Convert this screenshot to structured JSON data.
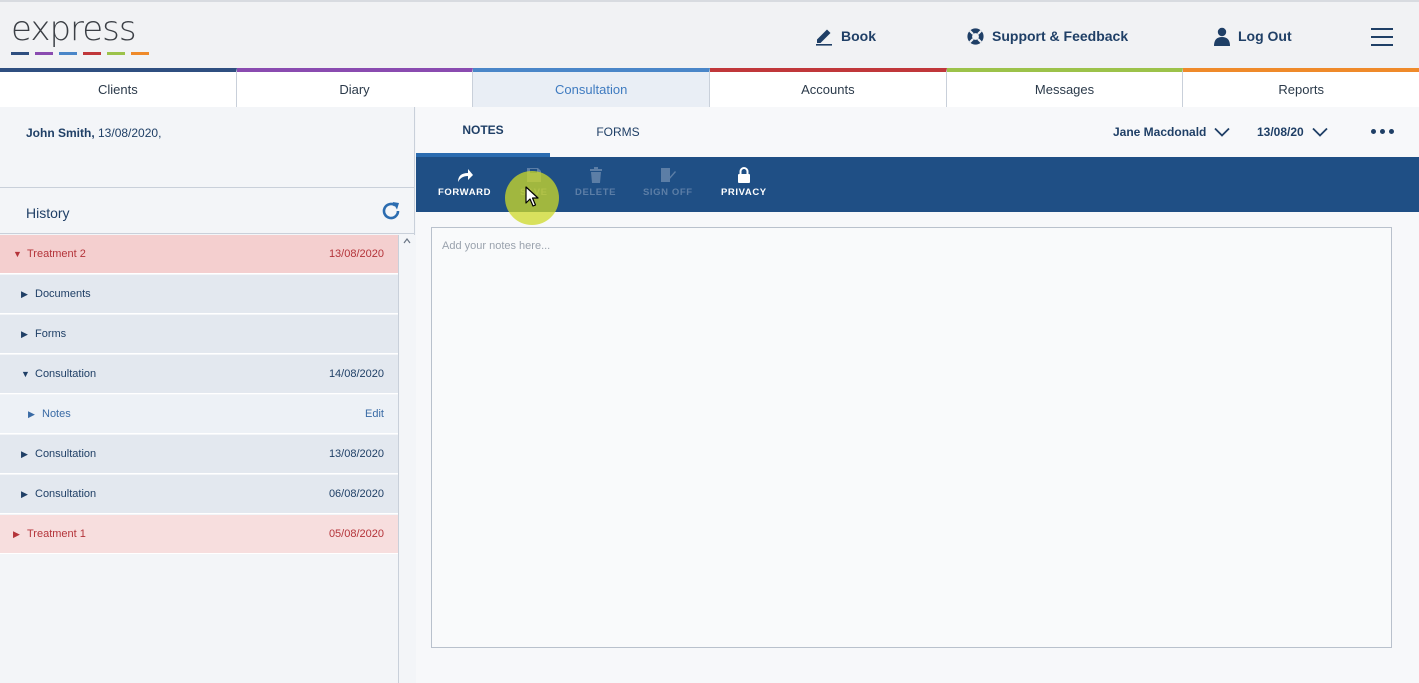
{
  "app": {
    "logo_text": "express",
    "logo_colors": [
      "#2f4f80",
      "#8a4bb0",
      "#4a86c8",
      "#c0373a",
      "#9cc24a",
      "#ef8a2a"
    ]
  },
  "header": {
    "book_label": "Book",
    "support_label": "Support & Feedback",
    "logout_label": "Log Out"
  },
  "nav": {
    "tabs": [
      {
        "label": "Clients",
        "color": "#2f4f80"
      },
      {
        "label": "Diary",
        "color": "#8a4bb0"
      },
      {
        "label": "Consultation",
        "color": "#4a86c8"
      },
      {
        "label": "Accounts",
        "color": "#c0373a"
      },
      {
        "label": "Messages",
        "color": "#9cc24a"
      },
      {
        "label": "Reports",
        "color": "#ef8a2a"
      }
    ],
    "active": "Consultation"
  },
  "patient": {
    "name": "John Smith,",
    "date": " 13/08/2020,"
  },
  "history": {
    "title": "History",
    "rows": [
      {
        "label": "Treatment 2",
        "date": "13/08/2020",
        "expanded": true
      },
      {
        "label": "Documents",
        "date": ""
      },
      {
        "label": "Forms",
        "date": ""
      },
      {
        "label": "Consultation",
        "date": "14/08/2020",
        "expanded": true
      },
      {
        "label": "Notes",
        "action": "Edit"
      },
      {
        "label": "Consultation",
        "date": "13/08/2020"
      },
      {
        "label": "Consultation",
        "date": "06/08/2020"
      },
      {
        "label": "Treatment 1",
        "date": "05/08/2020"
      }
    ]
  },
  "consultation": {
    "tabs": {
      "notes": "NOTES",
      "forms": "FORMS"
    },
    "practitioner": "Jane Macdonald",
    "date": "13/08/20",
    "toolbar": {
      "forward": "FORWARD",
      "save": "SAVE",
      "delete": "DELETE",
      "sign_off": "SIGN OFF",
      "privacy": "PRIVACY"
    },
    "notes_placeholder": "Add your notes here..."
  }
}
